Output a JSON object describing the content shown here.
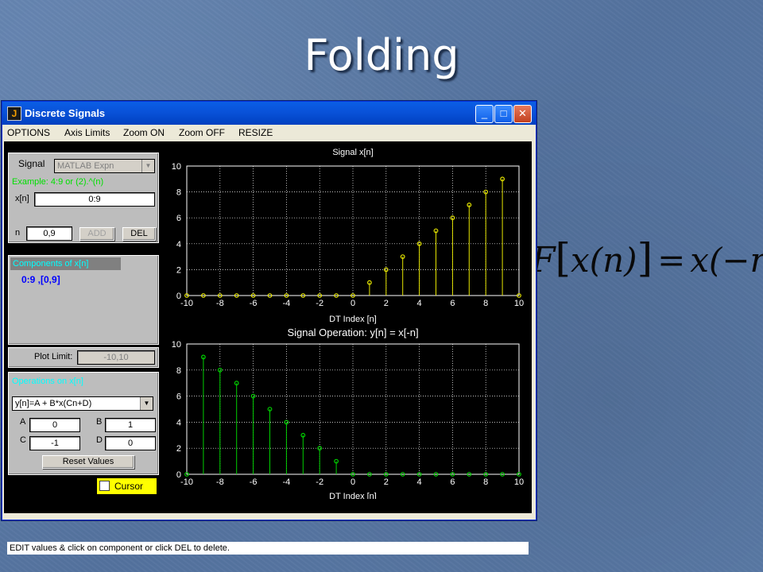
{
  "slide": {
    "title": "Folding",
    "formula": {
      "lhs_op": "F",
      "lhs_arg": "x(n)",
      "eq": "=",
      "rhs": "x(−n)"
    }
  },
  "window": {
    "title": "Discrete Signals",
    "app_icon": "matlab-figure-icon",
    "controls": {
      "minimize": "_",
      "maximize": "□",
      "close": "✕"
    },
    "menu": [
      "OPTIONS",
      "Axis Limits",
      "Zoom ON",
      "Zoom OFF",
      "RESIZE"
    ]
  },
  "signal_panel": {
    "signal_label": "Signal",
    "signal_select": "MATLAB Expn",
    "example": "Example: 4:9 or (2).^(n)",
    "xn_label": "x[n]",
    "xn_value": "0:9",
    "n_label": "n",
    "n_value": "0,9",
    "add_label": "ADD",
    "del_label": "DEL"
  },
  "components_panel": {
    "header": "Components of x[n]",
    "items": "0:9  ,[0,9]"
  },
  "plot_limit": {
    "label": "Plot Limit:",
    "value": "-10,10"
  },
  "operations_panel": {
    "header": "Operations on x[n]",
    "select": "y[n]=A + B*x(Cn+D)",
    "a_label": "A",
    "a_value": "0",
    "b_label": "B",
    "b_value": "1",
    "c_label": "C",
    "c_value": "-1",
    "d_label": "D",
    "d_value": "0",
    "reset_label": "Reset Values"
  },
  "cursor": {
    "label": "Cursor",
    "checked": false
  },
  "status_text": "EDIT values & click on component or click DEL to delete.",
  "colors": {
    "top_stem": "#e6e600",
    "bottom_stem": "#00d000",
    "panel_header": "#00ffff",
    "example_text": "#00e000"
  },
  "chart_data": [
    {
      "type": "stem",
      "title": "Signal  x[n]",
      "xlabel": "DT  Index   [n]",
      "ylabel": "",
      "xlim": [
        -10,
        10
      ],
      "ylim": [
        0,
        10
      ],
      "xticks": [
        -10,
        -8,
        -6,
        -4,
        -2,
        0,
        2,
        4,
        6,
        8,
        10
      ],
      "yticks": [
        0,
        2,
        4,
        6,
        8,
        10
      ],
      "grid": true,
      "x": [
        -10,
        -9,
        -8,
        -7,
        -6,
        -5,
        -4,
        -3,
        -2,
        -1,
        0,
        1,
        2,
        3,
        4,
        5,
        6,
        7,
        8,
        9,
        10
      ],
      "values": [
        0,
        0,
        0,
        0,
        0,
        0,
        0,
        0,
        0,
        0,
        0,
        1,
        2,
        3,
        4,
        5,
        6,
        7,
        8,
        9,
        0
      ]
    },
    {
      "type": "stem",
      "title": "Signal Operation:  y[n] = x[-n]",
      "xlabel": "DT  Index   [n]",
      "ylabel": "",
      "xlim": [
        -10,
        10
      ],
      "ylim": [
        0,
        10
      ],
      "xticks": [
        -10,
        -8,
        -6,
        -4,
        -2,
        0,
        2,
        4,
        6,
        8,
        10
      ],
      "yticks": [
        0,
        2,
        4,
        6,
        8,
        10
      ],
      "grid": true,
      "x": [
        -10,
        -9,
        -8,
        -7,
        -6,
        -5,
        -4,
        -3,
        -2,
        -1,
        0,
        1,
        2,
        3,
        4,
        5,
        6,
        7,
        8,
        9,
        10
      ],
      "values": [
        0,
        9,
        8,
        7,
        6,
        5,
        4,
        3,
        2,
        1,
        0,
        0,
        0,
        0,
        0,
        0,
        0,
        0,
        0,
        0,
        0
      ]
    }
  ]
}
